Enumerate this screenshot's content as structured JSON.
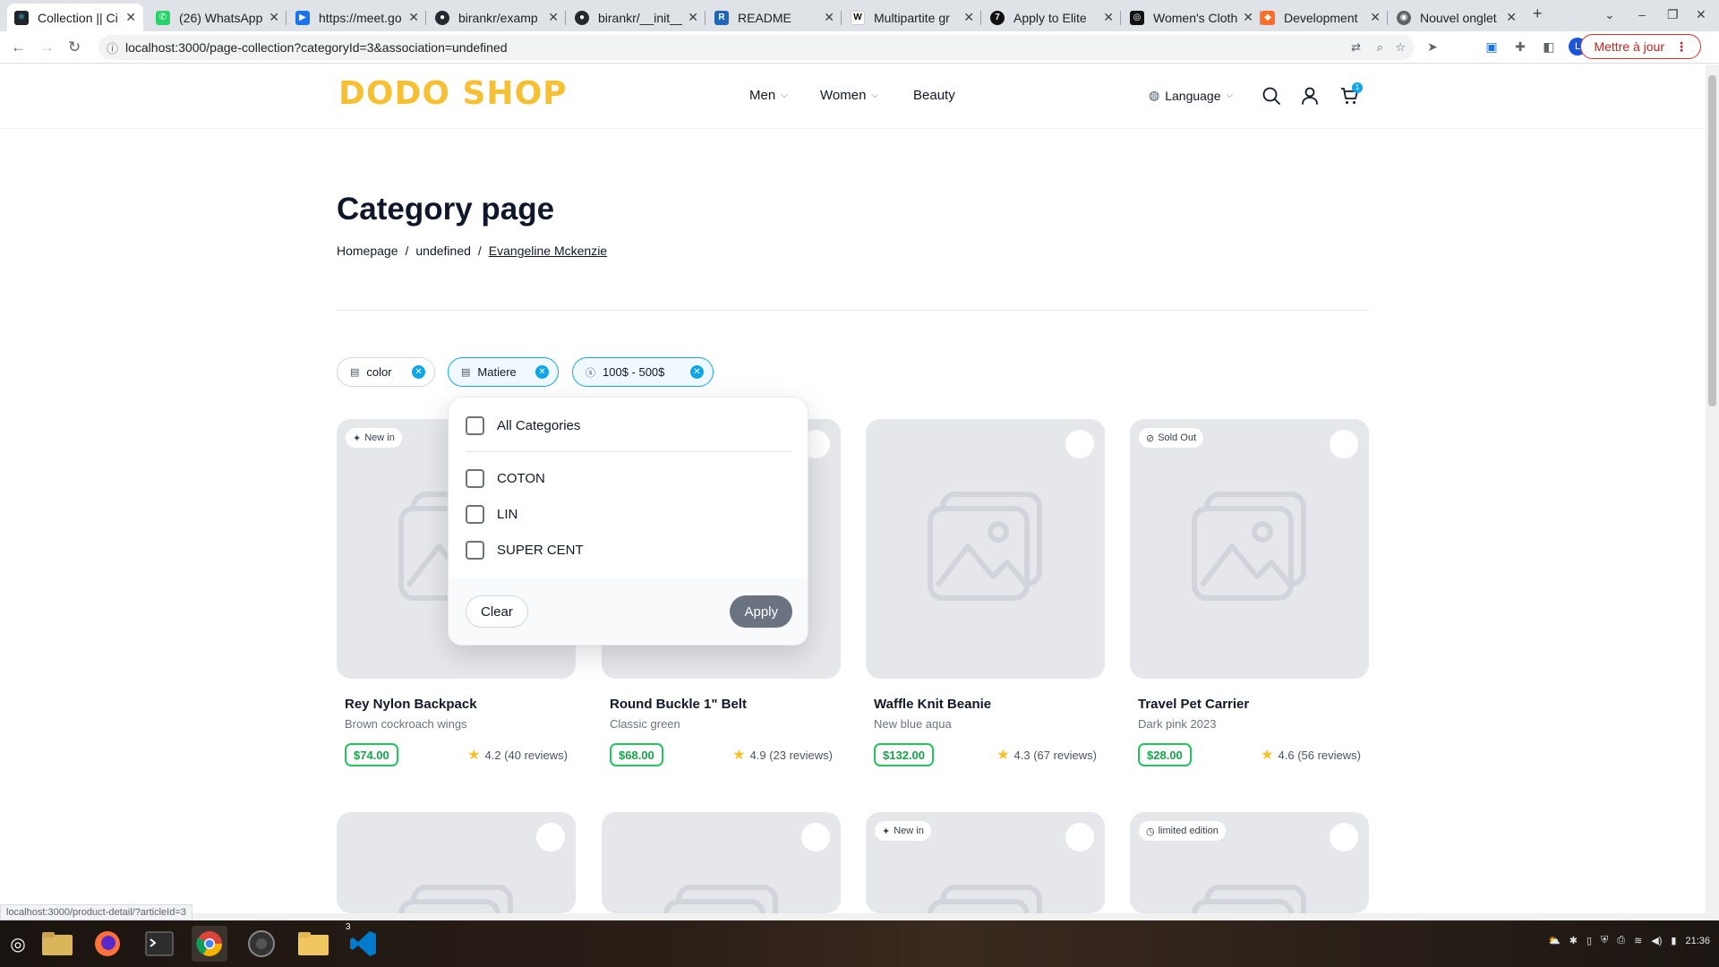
{
  "browser": {
    "tabs": [
      {
        "title": "Collection || Ci",
        "favicon": "react-icon",
        "color": "#20232a"
      },
      {
        "title": "(26) WhatsApp",
        "favicon": "whatsapp-icon",
        "color": "#25d366"
      },
      {
        "title": "https://meet.go",
        "favicon": "meet-icon",
        "color": "#1a73e8"
      },
      {
        "title": "birankr/examp",
        "favicon": "github-icon",
        "color": "#24292f"
      },
      {
        "title": "birankr/__init__",
        "favicon": "github-icon",
        "color": "#24292f"
      },
      {
        "title": "README",
        "favicon": "r-icon",
        "color": "#2165b6"
      },
      {
        "title": "Multipartite gr",
        "favicon": "wikipedia-icon",
        "color": "#ffffff"
      },
      {
        "title": "Apply to Elite",
        "favicon": "seven-icon",
        "color": "#111111"
      },
      {
        "title": "Women's Cloth",
        "favicon": "store-icon",
        "color": "#111111"
      },
      {
        "title": "Development",
        "favicon": "gitlab-icon",
        "color": "#fc6d26"
      },
      {
        "title": "Nouvel onglet",
        "favicon": "chrome-icon",
        "color": "#5f6368"
      }
    ],
    "url": "localhost:3000/page-collection?categoryId=3&association=undefined",
    "update_button": "Mettre à jour",
    "profile_initial": "L",
    "status_url": "localhost:3000/product-detail/?articleId=3"
  },
  "header": {
    "logo": "DODO SHOP",
    "nav": [
      {
        "label": "Men",
        "has_dropdown": true
      },
      {
        "label": "Women",
        "has_dropdown": true
      },
      {
        "label": "Beauty",
        "has_dropdown": false
      }
    ],
    "language_label": "Language",
    "cart_count": "1"
  },
  "page": {
    "title": "Category page",
    "breadcrumb": [
      "Homepage",
      "undefined",
      "Evangeline Mckenzie"
    ],
    "breadcrumb_sep": "/"
  },
  "filters": [
    {
      "label": "color",
      "active": false
    },
    {
      "label": "Matiere",
      "active": true
    },
    {
      "label": "100$ - 500$",
      "active": true
    }
  ],
  "dropdown": {
    "all_label": "All Categories",
    "options": [
      "COTON",
      "LIN",
      "SUPER CENT"
    ],
    "clear_label": "Clear",
    "apply_label": "Apply"
  },
  "products": [
    {
      "name": "Rey Nylon Backpack",
      "subtitle": "Brown cockroach wings",
      "price": "$74.00",
      "rating": "4.2 (40 reviews)",
      "badge": "New in",
      "favorite": false
    },
    {
      "name": "Round Buckle 1\" Belt",
      "subtitle": "Classic green",
      "price": "$68.00",
      "rating": "4.9 (23 reviews)",
      "badge": "",
      "favorite": false
    },
    {
      "name": "Waffle Knit Beanie",
      "subtitle": "New blue aqua",
      "price": "$132.00",
      "rating": "4.3 (67 reviews)",
      "badge": "",
      "favorite": false
    },
    {
      "name": "Travel Pet Carrier",
      "subtitle": "Dark pink 2023",
      "price": "$28.00",
      "rating": "4.6 (56 reviews)",
      "badge": "Sold Out",
      "favorite": true
    }
  ],
  "products_row2": [
    {
      "badge": "",
      "favorite": false
    },
    {
      "badge": "",
      "favorite": false
    },
    {
      "badge": "New in",
      "favorite": true
    },
    {
      "badge": "limited edition",
      "favorite": true
    }
  ],
  "system": {
    "time": "21:36",
    "workspace_count": "3"
  },
  "colors": {
    "logo": "#f7c033",
    "accent": "#0ea5e9",
    "price": "#22c55e",
    "favorite": "#ef4444"
  }
}
